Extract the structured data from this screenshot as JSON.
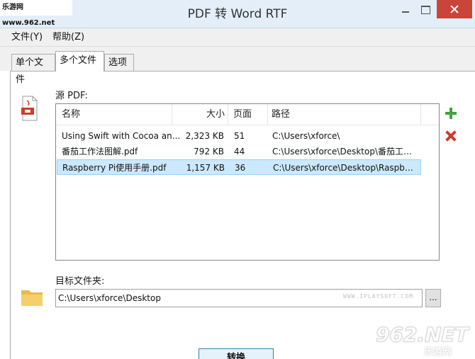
{
  "window": {
    "title": "PDF 转 Word RTF",
    "watermark_top": "乐游网 www.962.net"
  },
  "menu": {
    "file": "文件(Y)",
    "help": "帮助(Z)"
  },
  "tabs": [
    {
      "label": "单个文件",
      "selected": false
    },
    {
      "label": "多个文件",
      "selected": true
    },
    {
      "label": "选项",
      "selected": false
    }
  ],
  "source": {
    "label": "源 PDF:",
    "columns": {
      "name": "名称",
      "size": "大小",
      "pages": "页面",
      "path": "路径"
    },
    "rows": [
      {
        "name": "Using Swift with Cocoa an...",
        "size": "2,323 KB",
        "pages": "51",
        "path": "C:\\Users\\xforce\\",
        "selected": false
      },
      {
        "name": "番茄工作法图解.pdf",
        "size": "792 KB",
        "pages": "44",
        "path": "C:\\Users\\xforce\\Desktop\\番茄工作...",
        "selected": false
      },
      {
        "name": "Raspberry Pi使用手册.pdf",
        "size": "1,157 KB",
        "pages": "36",
        "path": "C:\\Users\\xforce\\Desktop\\Raspberry...",
        "selected": true
      }
    ]
  },
  "target": {
    "label": "目标文件夹:",
    "value": "C:\\Users\\xforce\\Desktop",
    "watermark": "WWW.IPLAYSOFT.COM",
    "browse_label": "..."
  },
  "convert_label": "转换",
  "watermark_bottom": {
    "main": "962.NET",
    "sub": "乐游网"
  },
  "icons": {
    "pdf": "pdf-file-icon",
    "folder": "folder-icon",
    "add": "plus-icon",
    "remove": "x-icon"
  },
  "colors": {
    "selected_row": "#cce8ff",
    "add": "#3ea43e",
    "remove": "#d23a2a",
    "close_button": "#c9453a"
  }
}
